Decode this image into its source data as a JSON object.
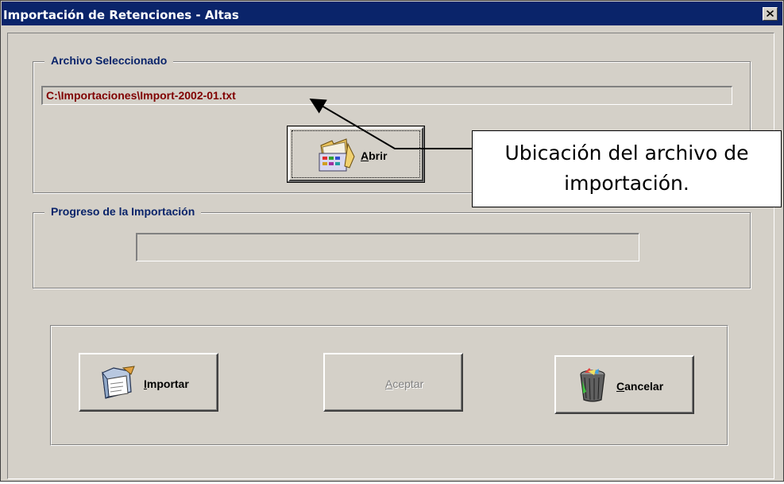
{
  "window": {
    "title": "Importación de Retenciones - Altas",
    "close_icon": "close-x-icon"
  },
  "file_group": {
    "legend": "Archivo Seleccionado",
    "file_path": "C:\\Importaciones\\Import-2002-01.txt",
    "open_button": {
      "label": "Abrir",
      "icon": "open-folder-icon"
    }
  },
  "progress_group": {
    "legend": "Progreso de la Importación",
    "progress_fraction": 0
  },
  "actions": {
    "import_button": {
      "label": "Importar",
      "icon": "import-folder-icon",
      "enabled": true
    },
    "accept_button": {
      "label": "Aceptar",
      "enabled": false
    },
    "cancel_button": {
      "label": "Cancelar",
      "icon": "trash-bin-icon",
      "enabled": true
    }
  },
  "annotation": {
    "text": "Ubicación del archivo de importación."
  },
  "colors": {
    "titlebar": "#0a246a",
    "face": "#d4d0c8",
    "legend_text": "#0a246a",
    "path_text": "#800000"
  }
}
